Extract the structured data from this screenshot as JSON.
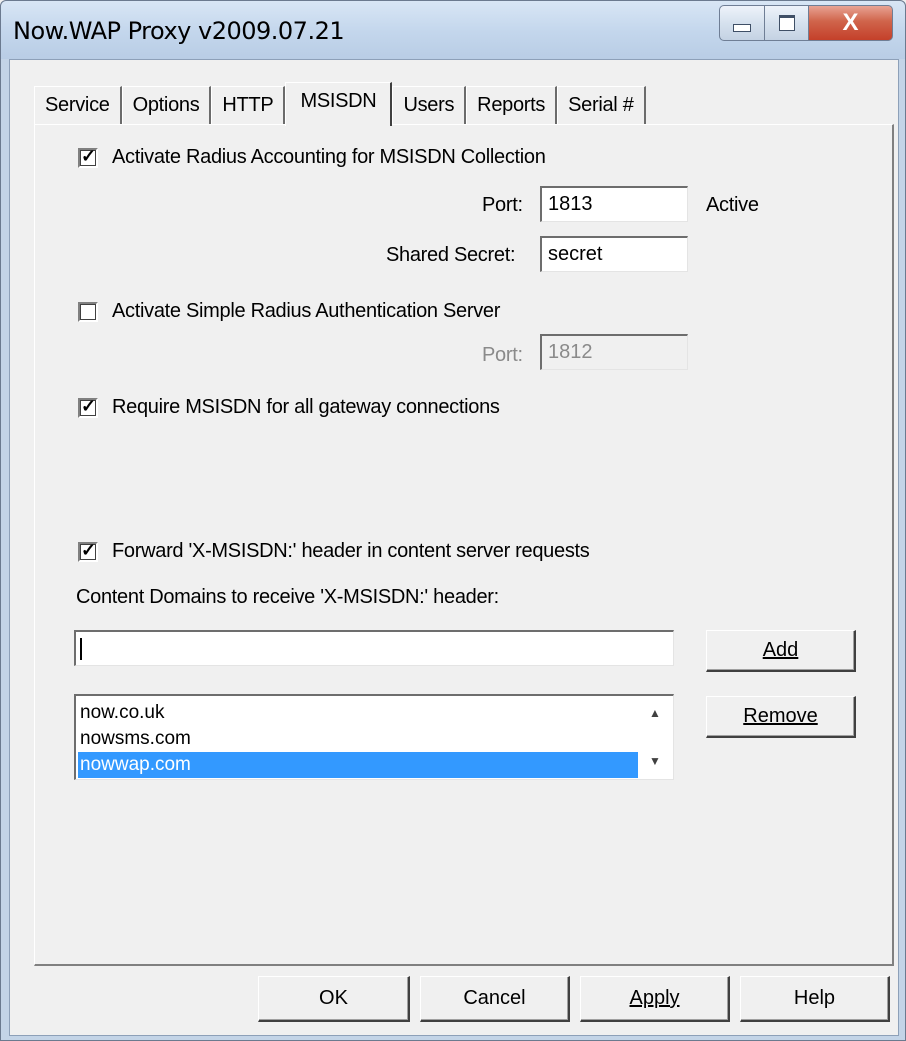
{
  "window": {
    "title": "Now.WAP Proxy v2009.07.21",
    "close_glyph": "X"
  },
  "tabs": [
    {
      "label": "Service"
    },
    {
      "label": "Options"
    },
    {
      "label": "HTTP"
    },
    {
      "label": "MSISDN",
      "active": true
    },
    {
      "label": "Users"
    },
    {
      "label": "Reports"
    },
    {
      "label": "Serial #"
    }
  ],
  "msisdn": {
    "radius_accounting": {
      "label": "Activate Radius Accounting for MSISDN Collection",
      "checked": true,
      "port_label": "Port:",
      "port_value": "1813",
      "status": "Active",
      "secret_label": "Shared Secret:",
      "secret_value": "secret"
    },
    "radius_auth": {
      "label": "Activate Simple Radius Authentication Server",
      "checked": false,
      "port_label": "Port:",
      "port_value": "1812"
    },
    "require": {
      "label": "Require MSISDN for all gateway connections",
      "checked": true
    },
    "forward": {
      "label": "Forward 'X-MSISDN:' header in content server requests",
      "checked": true
    },
    "domains_label": "Content Domains to receive 'X-MSISDN:' header:",
    "domain_input_value": "",
    "add_label": "Add",
    "remove_label": "Remove",
    "domains": [
      {
        "name": "now.co.uk",
        "selected": false
      },
      {
        "name": "nowsms.com",
        "selected": false
      },
      {
        "name": "nowwap.com",
        "selected": true
      }
    ]
  },
  "footer": {
    "ok": "OK",
    "cancel": "Cancel",
    "apply": "Apply",
    "help": "Help"
  },
  "colors": {
    "selection": "#3399ff",
    "close_button": "#c4402a"
  }
}
